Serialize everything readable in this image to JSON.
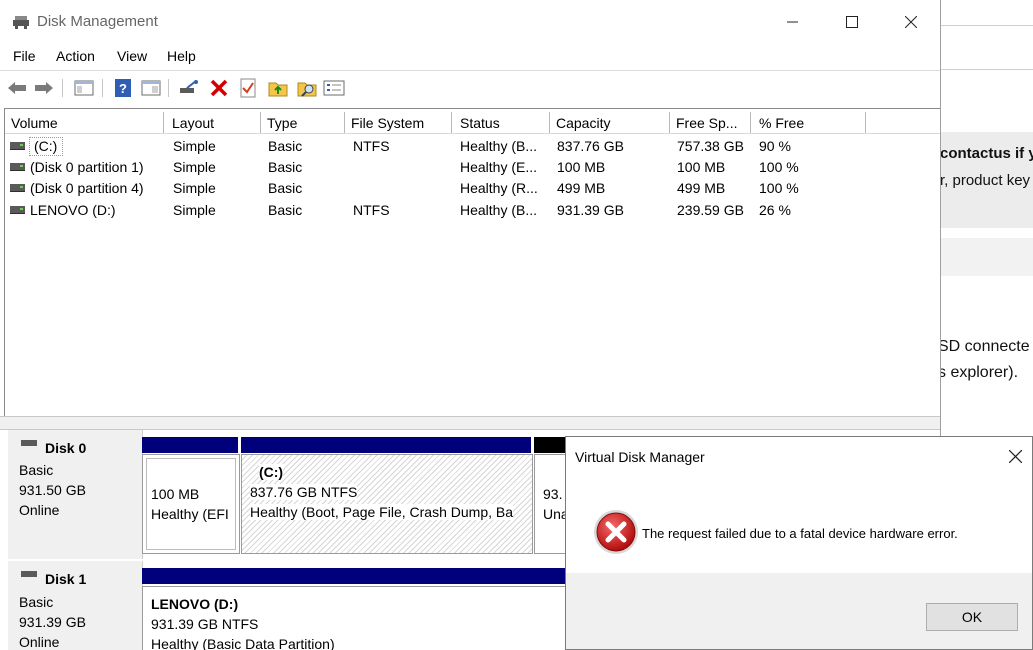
{
  "background_page": {
    "line1": "contactus if y",
    "line2": "r, product key",
    "line3": "SD connecte",
    "line4": "s explorer)."
  },
  "window": {
    "title": "Disk Management",
    "controls": {
      "minimize": "—",
      "maximize": "☐",
      "close": "✕"
    }
  },
  "menu": [
    "File",
    "Action",
    "View",
    "Help"
  ],
  "toolbar": [
    "back-icon",
    "forward-icon",
    "console-tree-icon",
    "help-icon",
    "properties-icon",
    "connect-icon",
    "delete-icon",
    "check-icon",
    "up-folder-icon",
    "search-folder-icon",
    "list-icon"
  ],
  "volume_list": {
    "columns": [
      "Volume",
      "Layout",
      "Type",
      "File System",
      "Status",
      "Capacity",
      "Free Sp...",
      "% Free"
    ],
    "rows": [
      {
        "volume": "(C:)",
        "layout": "Simple",
        "type": "Basic",
        "fs": "NTFS",
        "status": "Healthy (B...",
        "capacity": "837.76 GB",
        "free": "757.38 GB",
        "pct": "90 %"
      },
      {
        "volume": "(Disk 0 partition 1)",
        "layout": "Simple",
        "type": "Basic",
        "fs": "",
        "status": "Healthy (E...",
        "capacity": "100 MB",
        "free": "100 MB",
        "pct": "100 %"
      },
      {
        "volume": "(Disk 0 partition 4)",
        "layout": "Simple",
        "type": "Basic",
        "fs": "",
        "status": "Healthy (R...",
        "capacity": "499 MB",
        "free": "499 MB",
        "pct": "100 %"
      },
      {
        "volume": "LENOVO (D:)",
        "layout": "Simple",
        "type": "Basic",
        "fs": "NTFS",
        "status": "Healthy (B...",
        "capacity": "931.39 GB",
        "free": "239.59 GB",
        "pct": "26 %"
      }
    ]
  },
  "disks": [
    {
      "name": "Disk 0",
      "type": "Basic",
      "size": "931.50 GB",
      "state": "Online",
      "partitions": [
        {
          "title": "",
          "size": "100 MB",
          "status": "Healthy (EFI"
        },
        {
          "title": "(C:)",
          "size": "837.76 GB NTFS",
          "status": "Healthy (Boot, Page File, Crash Dump, Ba"
        },
        {
          "title": "",
          "size": "93.",
          "status": "Una"
        }
      ]
    },
    {
      "name": "Disk 1",
      "type": "Basic",
      "size": "931.39 GB",
      "state": "Online",
      "partitions": [
        {
          "title": "LENOVO  (D:)",
          "size": "931.39 GB NTFS",
          "status": "Healthy (Basic Data Partition)"
        }
      ]
    }
  ],
  "dialog": {
    "title": "Virtual Disk Manager",
    "message": "The request failed due to a fatal device hardware error.",
    "ok_label": "OK"
  }
}
